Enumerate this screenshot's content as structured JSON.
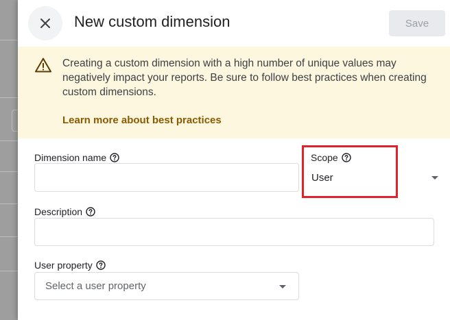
{
  "header": {
    "title": "New custom dimension",
    "save_label": "Save",
    "close_icon": "close-icon"
  },
  "warning": {
    "icon": "warning-icon",
    "text": "Creating a custom dimension with a high number of unique values may negatively impact your reports. Be sure to follow best practices when creating custom dimensions.",
    "link_label": "Learn more about best practices",
    "background": "#fef7e0",
    "link_color": "#8a5a00"
  },
  "form": {
    "dimension_name": {
      "label": "Dimension name",
      "value": ""
    },
    "scope": {
      "label": "Scope",
      "value": "User"
    },
    "description": {
      "label": "Description",
      "value": ""
    },
    "user_property": {
      "label": "User property",
      "placeholder": "Select a user property"
    }
  },
  "colors": {
    "highlight": "#e0222c",
    "save_disabled_bg": "#e8eaed",
    "save_disabled_text": "#9aa0a6"
  }
}
